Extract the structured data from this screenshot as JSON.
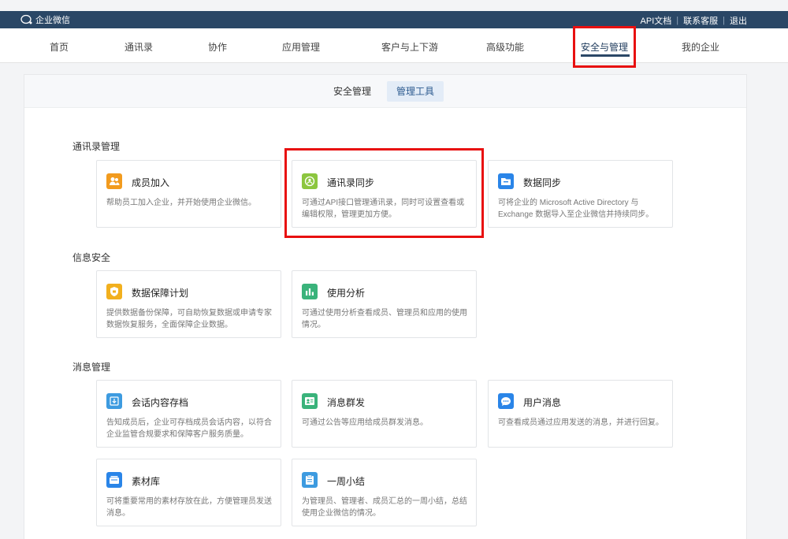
{
  "app": {
    "title": "企业微信"
  },
  "top_links": [
    "API文档",
    "联系客服",
    "退出"
  ],
  "nav": {
    "items": [
      "首页",
      "通讯录",
      "协作",
      "应用管理",
      "客户与上下游",
      "高级功能",
      "安全与管理",
      "我的企业"
    ],
    "active_index": 6
  },
  "subtabs": {
    "items": [
      "安全管理",
      "管理工具"
    ],
    "active_index": 1
  },
  "sections": [
    {
      "title": "通讯录管理",
      "tiles": [
        {
          "title": "成员加入",
          "desc": "帮助员工加入企业，并开始使用企业微信。",
          "icon": "members-join-icon",
          "color": "#f29b1e"
        },
        {
          "title": "通讯录同步",
          "desc": "可通过API接口管理通讯录，同时可设置查看或编辑权限，管理更加方便。",
          "icon": "contacts-sync-icon",
          "color": "#8cc63f"
        },
        {
          "title": "数据同步",
          "desc": "可将企业的 Microsoft Active Directory 与 Exchange 数据导入至企业微信并持续同步。",
          "icon": "data-sync-icon",
          "color": "#2a85e8"
        }
      ]
    },
    {
      "title": "信息安全",
      "tiles": [
        {
          "title": "数据保障计划",
          "desc": "提供数据备份保障，可自助恢复数据或申请专家数据恢复服务，全面保障企业数据。",
          "icon": "data-protection-icon",
          "color": "#f2b01e"
        },
        {
          "title": "使用分析",
          "desc": "可通过使用分析查看成员、管理员和应用的使用情况。",
          "icon": "usage-analysis-icon",
          "color": "#3ab37b"
        }
      ]
    },
    {
      "title": "消息管理",
      "tiles": [
        {
          "title": "会话内容存档",
          "desc": "告知成员后，企业可存档成员会话内容，以符合企业监管合规要求和保障客户服务质量。",
          "icon": "chat-archive-icon",
          "color": "#3d9be0"
        },
        {
          "title": "消息群发",
          "desc": "可通过公告等应用给成员群发消息。",
          "icon": "mass-message-icon",
          "color": "#3ab37b"
        },
        {
          "title": "用户消息",
          "desc": "可查看成员通过应用发送的消息，并进行回复。",
          "icon": "user-message-icon",
          "color": "#2a85e8"
        },
        {
          "title": "素材库",
          "desc": "可将重要常用的素材存放在此，方便管理员发送消息。",
          "icon": "material-library-icon",
          "color": "#2a85e8"
        },
        {
          "title": "一周小结",
          "desc": "为管理员、管理者、成员汇总的一周小结，总结使用企业微信的情况。",
          "icon": "weekly-summary-icon",
          "color": "#3d9be0"
        }
      ]
    }
  ]
}
